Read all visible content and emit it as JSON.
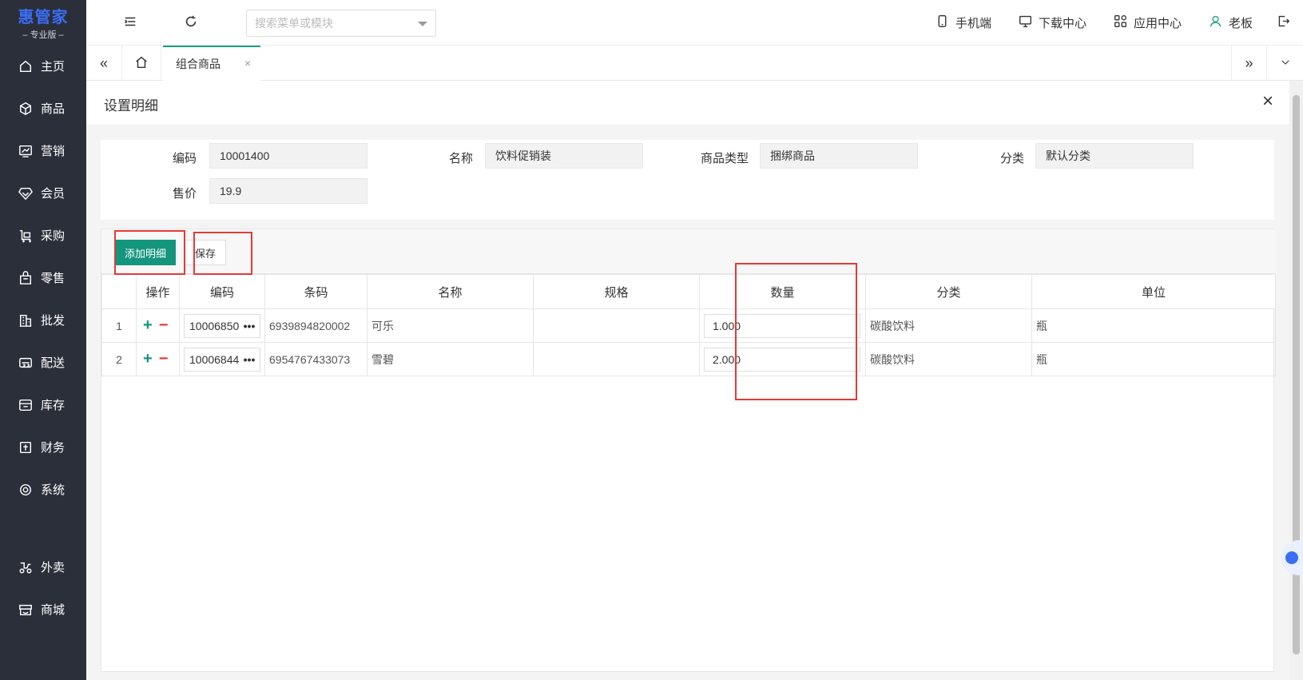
{
  "sidebar": {
    "logo_main": "惠管家",
    "logo_sub": "– 专业版 –",
    "items": [
      {
        "label": "主页",
        "icon": "home-icon"
      },
      {
        "label": "商品",
        "icon": "box-icon"
      },
      {
        "label": "营销",
        "icon": "trend-icon"
      },
      {
        "label": "会员",
        "icon": "diamond-icon"
      },
      {
        "label": "采购",
        "icon": "cart-icon"
      },
      {
        "label": "零售",
        "icon": "bag-icon"
      },
      {
        "label": "批发",
        "icon": "building-icon"
      },
      {
        "label": "配送",
        "icon": "delivery-icon"
      },
      {
        "label": "库存",
        "icon": "inventory-icon"
      },
      {
        "label": "财务",
        "icon": "finance-icon"
      },
      {
        "label": "系统",
        "icon": "settings-icon"
      },
      {
        "label": "外卖",
        "icon": "scooter-icon"
      },
      {
        "label": "商城",
        "icon": "store-icon"
      }
    ]
  },
  "topbar": {
    "search_placeholder": "搜索菜单或模块",
    "mobile": "手机端",
    "download": "下载中心",
    "apps": "应用中心",
    "user": "老板"
  },
  "tabs": {
    "active": "组合商品",
    "close": "×"
  },
  "panel": {
    "title": "设置明细",
    "close": "×"
  },
  "form": {
    "code_label": "编码",
    "code_value": "10001400",
    "name_label": "名称",
    "name_value": "饮料促销装",
    "type_label": "商品类型",
    "type_value": "捆绑商品",
    "category_label": "分类",
    "category_value": "默认分类",
    "price_label": "售价",
    "price_value": "19.9"
  },
  "toolbar": {
    "add_label": "添加明细",
    "save_label": "保存"
  },
  "grid": {
    "headers": [
      "",
      "操作",
      "编码",
      "条码",
      "名称",
      "规格",
      "数量",
      "分类",
      "单位"
    ],
    "rows": [
      {
        "idx": "1",
        "code": "10006850",
        "barcode": "6939894820002",
        "name": "可乐",
        "spec": "",
        "qty": "1.000",
        "category": "碳酸饮料",
        "unit": "瓶"
      },
      {
        "idx": "2",
        "code": "10006844",
        "barcode": "6954767433073",
        "name": "雪碧",
        "spec": "",
        "qty": "2.000",
        "category": "碳酸饮料",
        "unit": "瓶"
      }
    ],
    "more": "•••",
    "plus": "+",
    "minus": "−"
  }
}
